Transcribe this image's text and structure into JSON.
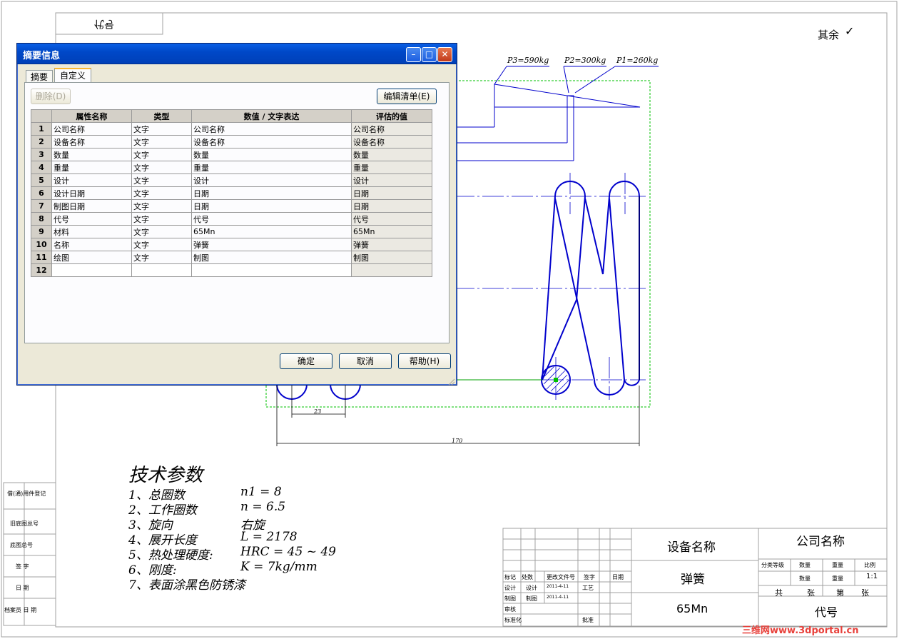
{
  "drawing": {
    "mirror_label": "代号",
    "roughness_label": "其余",
    "roughness_symbol": "✓",
    "loads": [
      "P3=590kg",
      "P2=300kg",
      "P1=260kg"
    ],
    "dim_pitch": "23",
    "dim_length": "170",
    "tech_title": "技术参数",
    "tech_params": [
      {
        "label": "1、总圈数",
        "value": "n1 = 8"
      },
      {
        "label": "2、工作圈数",
        "value": "n = 6.5"
      },
      {
        "label": "3、旋向",
        "value": "右旋"
      },
      {
        "label": "4、展开长度",
        "value": "L = 2178"
      },
      {
        "label": "5、热处理硬度:",
        "value": "HRC = 45 ~ 49"
      },
      {
        "label": "6、刚度:",
        "value": "K = 7kg/mm"
      },
      {
        "label": "7、表面涂黑色防锈漆",
        "value": ""
      }
    ],
    "left_strip": [
      "借(通)用件登记",
      "旧底图总号",
      "底图总号",
      "签 字",
      "日 期",
      "档案员 日 期"
    ],
    "title_block": {
      "device_name": "设备名称",
      "part_name": "弹簧",
      "material": "65Mn",
      "company": "公司名称",
      "code": "代号",
      "header_cols": [
        "分类等级",
        "数量",
        "重量",
        "比例"
      ],
      "values": [
        "数量",
        "重量",
        "1:1"
      ],
      "sheets": [
        "共",
        "张",
        "第",
        "张"
      ],
      "sign_rows": [
        [
          "标记",
          "处数",
          "更改文件号",
          "签字",
          "日期"
        ],
        [
          "设计",
          "设计",
          "2011-4-11",
          "工艺",
          ""
        ],
        [
          "制图",
          "制图",
          "2011-4-11",
          "",
          ""
        ],
        [
          "审核",
          "",
          "",
          "",
          ""
        ],
        [
          "标准化",
          "",
          "",
          "批准",
          ""
        ]
      ]
    },
    "watermark": "三维网www.3dportal.cn",
    "colors": {
      "line": "#0000cc",
      "frame": "#a0a0a0",
      "center": "#00a000",
      "green": "#00c000"
    }
  },
  "dialog": {
    "title": "摘要信息",
    "tabs": [
      "摘要",
      "自定义"
    ],
    "delete_label": "删除(D)",
    "edit_list_label": "编辑清单(E)",
    "columns": [
      "属性名称",
      "类型",
      "数值 / 文字表达",
      "评估的值"
    ],
    "rows": [
      {
        "num": "1",
        "name": "公司名称",
        "type": "文字",
        "expr": "公司名称",
        "eval": "公司名称"
      },
      {
        "num": "2",
        "name": "设备名称",
        "type": "文字",
        "expr": "设备名称",
        "eval": "设备名称"
      },
      {
        "num": "3",
        "name": "数量",
        "type": "文字",
        "expr": "数量",
        "eval": "数量"
      },
      {
        "num": "4",
        "name": "重量",
        "type": "文字",
        "expr": "重量",
        "eval": "重量"
      },
      {
        "num": "5",
        "name": "设计",
        "type": "文字",
        "expr": "设计",
        "eval": "设计"
      },
      {
        "num": "6",
        "name": "设计日期",
        "type": "文字",
        "expr": "日期",
        "eval": "日期"
      },
      {
        "num": "7",
        "name": "制图日期",
        "type": "文字",
        "expr": "日期",
        "eval": "日期"
      },
      {
        "num": "8",
        "name": "代号",
        "type": "文字",
        "expr": "代号",
        "eval": "代号"
      },
      {
        "num": "9",
        "name": "材料",
        "type": "文字",
        "expr": "65Mn",
        "eval": "65Mn"
      },
      {
        "num": "10",
        "name": "名称",
        "type": "文字",
        "expr": "弹簧",
        "eval": "弹簧"
      },
      {
        "num": "11",
        "name": "绘图",
        "type": "文字",
        "expr": "制图",
        "eval": "制图"
      },
      {
        "num": "12",
        "name": "",
        "type": "",
        "expr": "",
        "eval": ""
      }
    ],
    "ok_label": "确定",
    "cancel_label": "取消",
    "help_label": "帮助(H)"
  }
}
